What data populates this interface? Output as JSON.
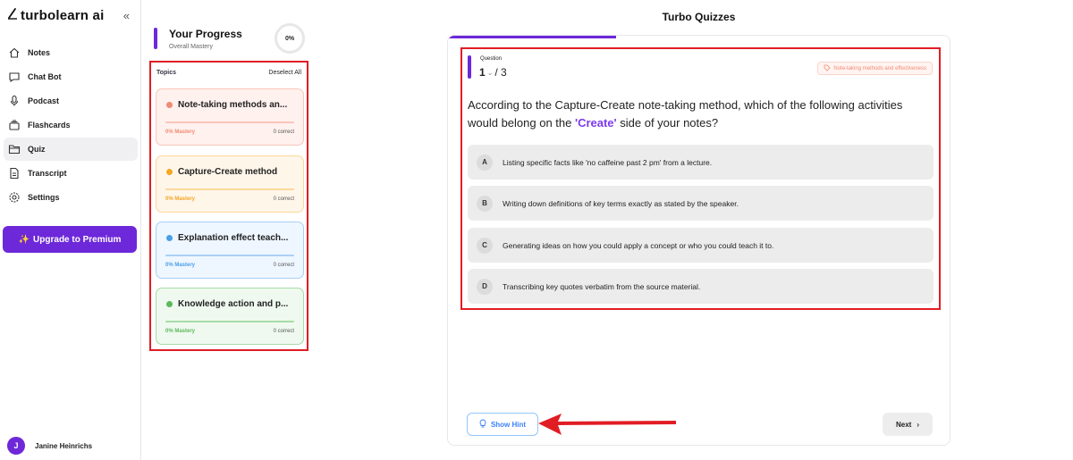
{
  "sidebar": {
    "brand": "turbolearn ai",
    "items": [
      {
        "label": "Notes",
        "icon": "home-icon",
        "active": false
      },
      {
        "label": "Chat Bot",
        "icon": "chat-icon",
        "active": false
      },
      {
        "label": "Podcast",
        "icon": "microphone-icon",
        "active": false
      },
      {
        "label": "Flashcards",
        "icon": "flashcards-icon",
        "active": false
      },
      {
        "label": "Quiz",
        "icon": "folder-icon",
        "active": true
      },
      {
        "label": "Transcript",
        "icon": "document-icon",
        "active": false
      },
      {
        "label": "Settings",
        "icon": "gear-icon",
        "active": false
      }
    ],
    "upgrade_label": "Upgrade to Premium",
    "upgrade_icon": "sparkle-icon",
    "user": {
      "initial": "J",
      "name": "Janine Heinrichs"
    }
  },
  "progress": {
    "title": "Your Progress",
    "subtitle": "Overall Mastery",
    "percent": "0%"
  },
  "topics": {
    "label": "Topics",
    "deselect": "Deselect All",
    "items": [
      {
        "title": "Note-taking methods an...",
        "mastery": "0% Mastery",
        "correct": "0 correct",
        "color": "#f28b73",
        "bg": "#fff1ee",
        "border": "#f9c6b9"
      },
      {
        "title": "Capture-Create method",
        "mastery": "0% Mastery",
        "correct": "0 correct",
        "color": "#f5a623",
        "bg": "#fff6ea",
        "border": "#fcd79a"
      },
      {
        "title": "Explanation effect teach...",
        "mastery": "0% Mastery",
        "correct": "0 correct",
        "color": "#4a9fe8",
        "bg": "#eef6ff",
        "border": "#a9d0f5"
      },
      {
        "title": "Knowledge action and p...",
        "mastery": "0% Mastery",
        "correct": "0 correct",
        "color": "#5cb85c",
        "bg": "#eff9ef",
        "border": "#a8dca8"
      }
    ]
  },
  "quiz": {
    "title": "Turbo Quizzes",
    "question_label": "Question",
    "current": "1",
    "total": "/ 3",
    "tag": "Note-taking methods and effectiveness",
    "question_before": "According to the Capture-Create note-taking method, which of the following activities would belong on the ",
    "question_highlight": "'Create'",
    "question_after": " side of your notes?",
    "options": [
      {
        "letter": "A",
        "text": "Listing specific facts like 'no caffeine past 2 pm' from a lecture."
      },
      {
        "letter": "B",
        "text": "Writing down definitions of key terms exactly as stated by the speaker."
      },
      {
        "letter": "C",
        "text": "Generating ideas on how you could apply a concept or who you could teach it to."
      },
      {
        "letter": "D",
        "text": "Transcribing key quotes verbatim from the source material."
      }
    ],
    "hint_label": "Show Hint",
    "next_label": "Next"
  },
  "colors": {
    "accent": "#6d28d9",
    "annotation": "#e11d24"
  }
}
